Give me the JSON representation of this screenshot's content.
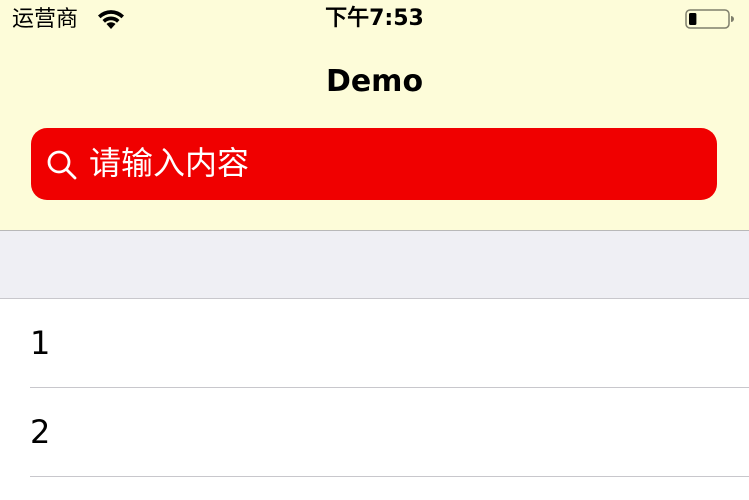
{
  "status_bar": {
    "carrier": "运营商",
    "time": "下午7:53",
    "wifi_icon": "wifi-icon",
    "battery_icon": "battery-icon",
    "battery_level": 0.2
  },
  "nav": {
    "title": "Demo"
  },
  "search": {
    "placeholder": "请输入内容",
    "value": "",
    "icon": "search-icon",
    "background_color": "#f00000"
  },
  "colors": {
    "top_background": "#fdfcd9",
    "section_background": "#efeff4"
  },
  "list": {
    "items": [
      {
        "label": "1"
      },
      {
        "label": "2"
      }
    ]
  }
}
